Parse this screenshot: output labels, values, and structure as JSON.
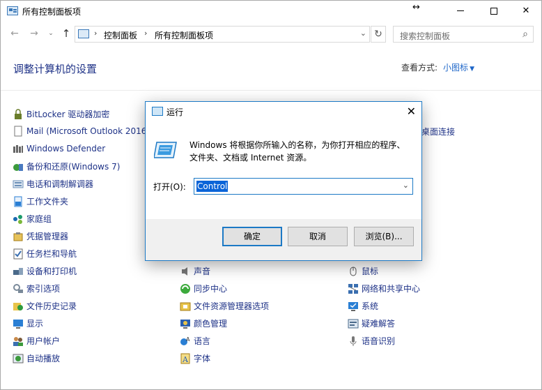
{
  "window": {
    "title": "所有控制面板项",
    "resize_cursor": "↔",
    "min_label": "",
    "max_label": "",
    "close_label": "✕"
  },
  "nav": {
    "back": "←",
    "forward": "→",
    "recent": "⌄",
    "up": "↑",
    "breadcrumb": [
      "控制面板",
      "所有控制面板项"
    ],
    "sep": "›",
    "address_dropdown": "⌄",
    "refresh": "↻",
    "search_placeholder": "搜索控制面板",
    "search_icon": "⌕"
  },
  "header": {
    "title": "调整计算机的设置",
    "view_by_label": "查看方式:",
    "view_by_value": "小图标",
    "view_by_caret": "▼"
  },
  "items": {
    "col1": [
      {
        "label": "BitLocker 驱动器加密",
        "icon": "bitlocker-icon",
        "color": "#6a7d2a"
      },
      {
        "label": "Mail (Microsoft Outlook 2016)",
        "icon": "mail-icon",
        "color": "#ffffff"
      },
      {
        "label": "Windows Defender",
        "icon": "defender-icon",
        "color": "#666666"
      },
      {
        "label": "备份和还原(Windows 7)",
        "icon": "backup-icon",
        "color": "#3c9a3c"
      },
      {
        "label": "电话和调制解调器",
        "icon": "phone-modem-icon",
        "color": "#6b8fb8"
      },
      {
        "label": "工作文件夹",
        "icon": "work-folders-icon",
        "color": "#2a7fd4"
      },
      {
        "label": "家庭组",
        "icon": "homegroup-icon",
        "color": "#1a9b6a"
      },
      {
        "label": "凭据管理器",
        "icon": "credential-manager-icon",
        "color": "#c79a2a"
      },
      {
        "label": "任务栏和导航",
        "icon": "taskbar-icon",
        "color": "#3a6fb0"
      },
      {
        "label": "设备和打印机",
        "icon": "devices-printers-icon",
        "color": "#4a6a8a"
      },
      {
        "label": "索引选项",
        "icon": "indexing-icon",
        "color": "#7a8a9a"
      },
      {
        "label": "文件历史记录",
        "icon": "file-history-icon",
        "color": "#2e9b3e"
      },
      {
        "label": "显示",
        "icon": "display-icon",
        "color": "#2a7fd4"
      },
      {
        "label": "用户帐户",
        "icon": "user-accounts-icon",
        "color": "#3a6fb0"
      },
      {
        "label": "自动播放",
        "icon": "autoplay-icon",
        "color": "#3c9a3c"
      }
    ],
    "col2": [
      {
        "label": "声音",
        "icon": "sound-icon",
        "color": "#777777"
      },
      {
        "label": "同步中心",
        "icon": "sync-center-icon",
        "color": "#3caa3c"
      },
      {
        "label": "文件资源管理器选项",
        "icon": "explorer-options-icon",
        "color": "#d6b340"
      },
      {
        "label": "颜色管理",
        "icon": "color-management-icon",
        "color": "#2a5fb0"
      },
      {
        "label": "语言",
        "icon": "language-icon",
        "color": "#2a7fd4"
      },
      {
        "label": "字体",
        "icon": "fonts-icon",
        "color": "#d6b340"
      }
    ],
    "col3_partial": "桌面连接",
    "col3": [
      {
        "label": "鼠标",
        "icon": "mouse-icon",
        "color": "#555555"
      },
      {
        "label": "网络和共享中心",
        "icon": "network-sharing-icon",
        "color": "#3a6fb0"
      },
      {
        "label": "系统",
        "icon": "system-icon",
        "color": "#2a7fd4"
      },
      {
        "label": "疑难解答",
        "icon": "troubleshooting-icon",
        "color": "#4a6a8a"
      },
      {
        "label": "语音识别",
        "icon": "speech-recognition-icon",
        "color": "#777777"
      }
    ]
  },
  "dialog": {
    "title": "运行",
    "close": "✕",
    "description": "Windows 将根据你所输入的名称，为你打开相应的程序、文件夹、文档或 Internet 资源。",
    "open_label": "打开(O):",
    "open_value": "Control",
    "open_dropdown": "⌄",
    "ok_label": "确定",
    "cancel_label": "取消",
    "browse_label": "浏览(B)..."
  }
}
